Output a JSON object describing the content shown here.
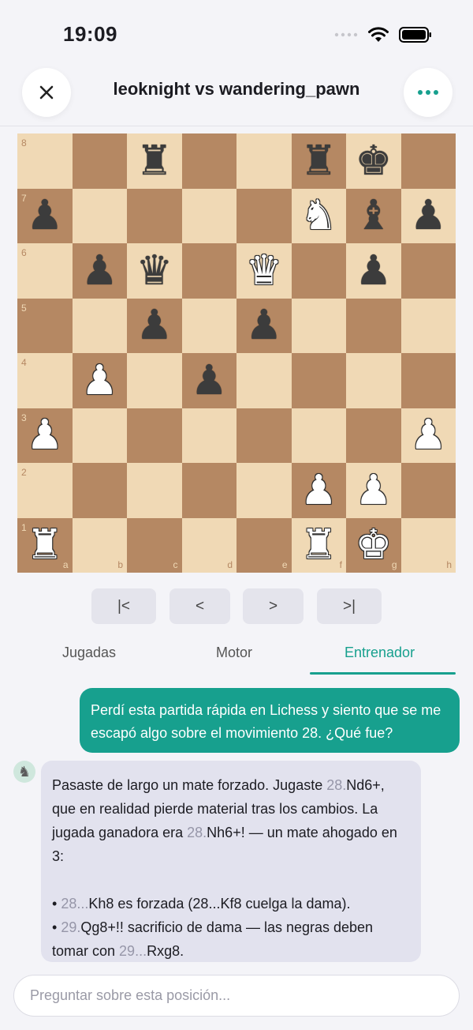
{
  "status": {
    "time": "19:09"
  },
  "header": {
    "title": "leoknight vs wandering_pawn",
    "close_icon": "close-icon",
    "more_icon": "more-dots-icon"
  },
  "board": {
    "files": [
      "a",
      "b",
      "c",
      "d",
      "e",
      "f",
      "g",
      "h"
    ],
    "ranks": [
      "8",
      "7",
      "6",
      "5",
      "4",
      "3",
      "2",
      "1"
    ],
    "position": [
      [
        "",
        "",
        "r",
        "",
        "",
        "r",
        "k",
        ""
      ],
      [
        "p",
        "",
        "",
        "",
        "",
        "N",
        "b",
        "p"
      ],
      [
        "",
        "p",
        "q",
        "",
        "Q",
        "",
        "p",
        ""
      ],
      [
        "",
        "",
        "p",
        "",
        "p",
        "",
        "",
        ""
      ],
      [
        "",
        "P",
        "",
        "p",
        "",
        "",
        "",
        ""
      ],
      [
        "P",
        "",
        "",
        "",
        "",
        "",
        "",
        "P"
      ],
      [
        "",
        "",
        "",
        "",
        "",
        "P",
        "P",
        ""
      ],
      [
        "R",
        "",
        "",
        "",
        "",
        "R",
        "K",
        ""
      ]
    ]
  },
  "nav": {
    "first": "|<",
    "prev": "<",
    "next": ">",
    "last": ">|"
  },
  "tabs": [
    {
      "label": "Jugadas",
      "active": false
    },
    {
      "label": "Motor",
      "active": false
    },
    {
      "label": "Entrenador",
      "active": true
    }
  ],
  "chat": {
    "user_message": "Perdí esta partida rápida en Lichess y siento que se me escapó algo sobre el movimiento 28. ¿Qué fue?",
    "bot": {
      "p1_a": "Pasaste de largo un mate forzado. Jugaste ",
      "p1_m1_num": "28.",
      "p1_m1_san": "Nd6+",
      "p1_b": ", que en realidad pierde material tras los cambios. La jugada ganadora era ",
      "p1_m2_num": "28.",
      "p1_m2_san": "Nh6+!",
      "p1_c": " — un mate ahogado en 3:",
      "b1_num": "28...",
      "b1_san": "Kh8",
      "b1_text": " es forzada (28...Kf8 cuelga la dama).",
      "b2_num": "29.",
      "b2_san": "Qg8+!!",
      "b2_text": " sacrificio de dama — las negras deben tomar con ",
      "b2_num2": "29...",
      "b2_san2": "Rxg8",
      "b2_end": "."
    }
  },
  "input": {
    "placeholder": "Preguntar sobre esta posición..."
  },
  "colors": {
    "accent": "#17a08e",
    "light_square": "#f0d9b5",
    "dark_square": "#b58863"
  }
}
